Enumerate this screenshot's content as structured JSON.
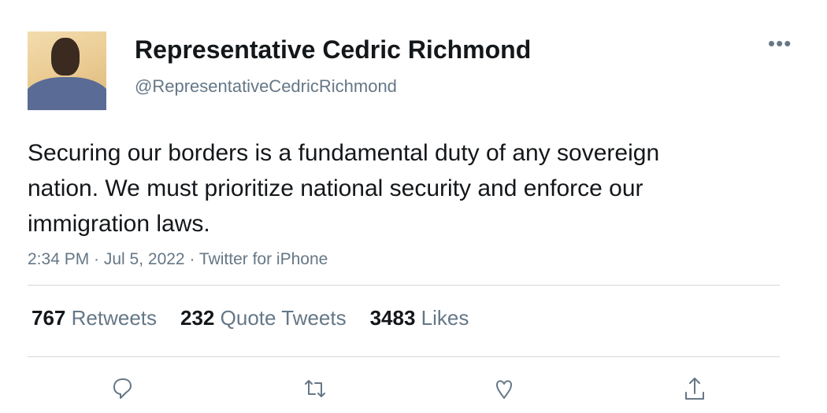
{
  "author": {
    "name": "Representative Cedric Richmond",
    "handle": "@RepresentativeCedricRichmond"
  },
  "tweet": {
    "text": "Securing our borders is a fundamental duty of any sovereign nation. We must prioritize national security and enforce our immigration laws.",
    "meta": "2:34 PM · Jul 5, 2022 · Twitter for iPhone"
  },
  "stats": {
    "retweets": {
      "count": "767",
      "label": "Retweets"
    },
    "quotes": {
      "count": "232",
      "label": "Quote Tweets"
    },
    "likes": {
      "count": "3483",
      "label": "Likes"
    }
  },
  "more_label": "•••",
  "icons": [
    "reply-icon",
    "retweet-icon",
    "like-icon",
    "share-icon"
  ]
}
